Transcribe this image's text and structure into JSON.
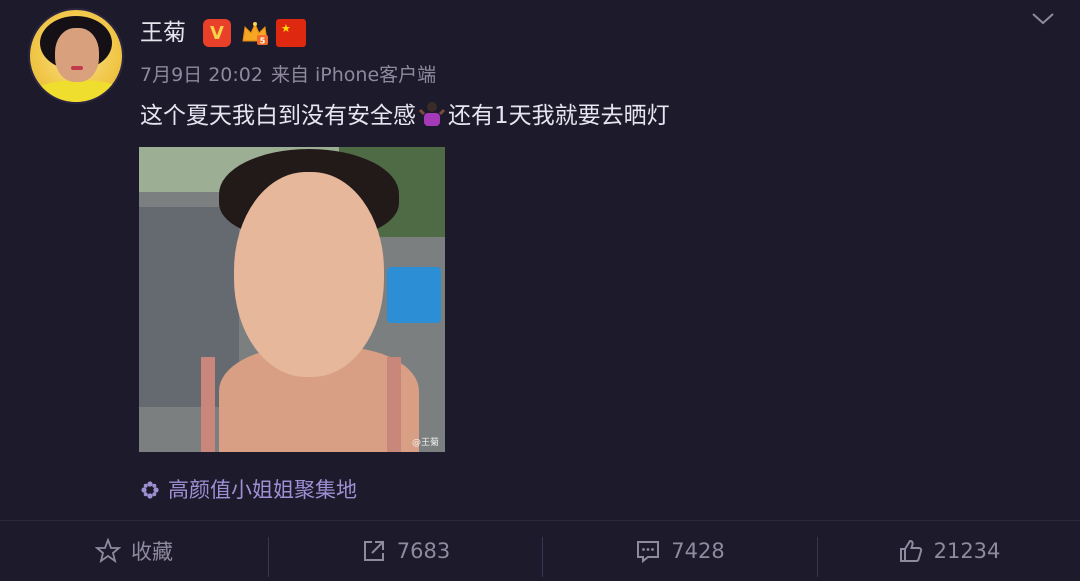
{
  "post": {
    "username": "王菊",
    "time": "7月9日 20:02",
    "source": "来自 iPhone客户端",
    "text_before": "这个夏天我白到没有安全感",
    "text_after": "还有1天我就要去晒灯",
    "watermark": "@王菊",
    "topic": "高颜值小姐姐聚集地"
  },
  "icons": {
    "verified": "verified-v-icon",
    "crown": "crown-level-icon",
    "flag": "china-flag-icon",
    "chevron": "chevron-down-icon",
    "emoji": "woman-shrugging-emoji",
    "topic": "flower-topic-icon"
  },
  "actions": {
    "favorite_label": "收藏",
    "repost_count": "7683",
    "comment_count": "7428",
    "like_count": "21234"
  },
  "colors": {
    "background": "#1d1a2b",
    "topic": "#9f8fd3",
    "verified": "#e9402a"
  }
}
